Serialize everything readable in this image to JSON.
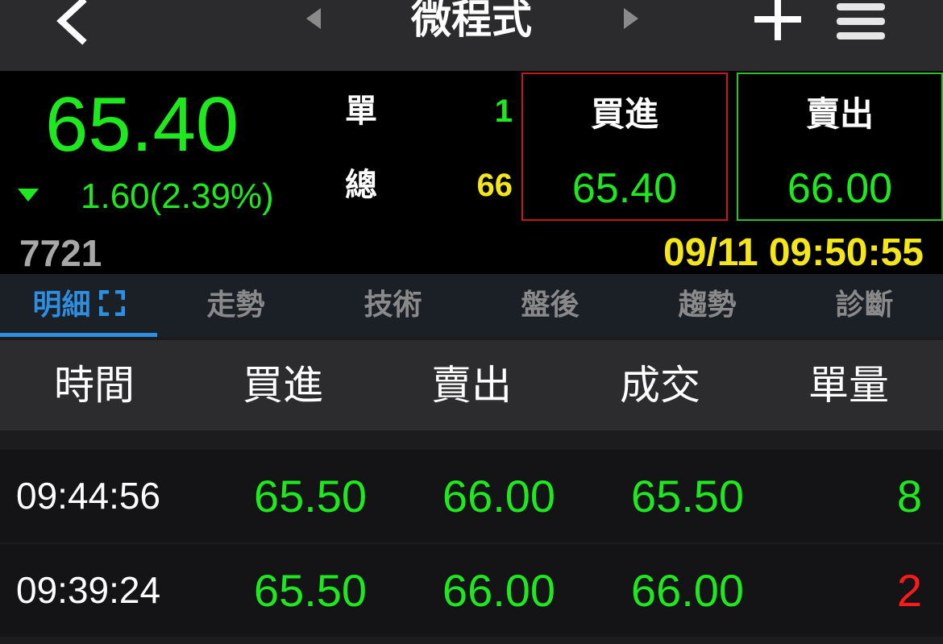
{
  "nav": {
    "title": "微程式",
    "icons": [
      "back-icon",
      "prev-icon",
      "next-icon",
      "plus-icon",
      "menu-icon"
    ]
  },
  "quote": {
    "price": "65.40",
    "change": "1.60(2.39%)",
    "direction": "down",
    "code": "7721",
    "single_label": "單",
    "single_value": "1",
    "total_label": "總",
    "total_value": "66",
    "buy_label": "買進",
    "buy_price": "65.40",
    "sell_label": "賣出",
    "sell_price": "66.00",
    "datetime": "09/11 09:50:55"
  },
  "tabs": [
    {
      "label": "明細",
      "active": true
    },
    {
      "label": "走勢"
    },
    {
      "label": "技術"
    },
    {
      "label": "盤後"
    },
    {
      "label": "趨勢"
    },
    {
      "label": "診斷"
    }
  ],
  "table": {
    "headers": [
      "時間",
      "買進",
      "賣出",
      "成交",
      "單量"
    ],
    "rows": [
      {
        "time": "09:44:56",
        "bid": "65.50",
        "ask": "66.00",
        "trade": "65.50",
        "volume": "8",
        "volume_color": "#1ee81e"
      },
      {
        "time": "09:39:24",
        "bid": "65.50",
        "ask": "66.00",
        "trade": "66.00",
        "volume": "2",
        "volume_color": "#ff1a1a"
      }
    ]
  },
  "colors": {
    "up_green": "#1ee81e",
    "down_red": "#ff1a1a",
    "highlight_yellow": "#f5e617",
    "accent_blue": "#2e8fe0",
    "nav_bg": "#2b2b2d"
  }
}
